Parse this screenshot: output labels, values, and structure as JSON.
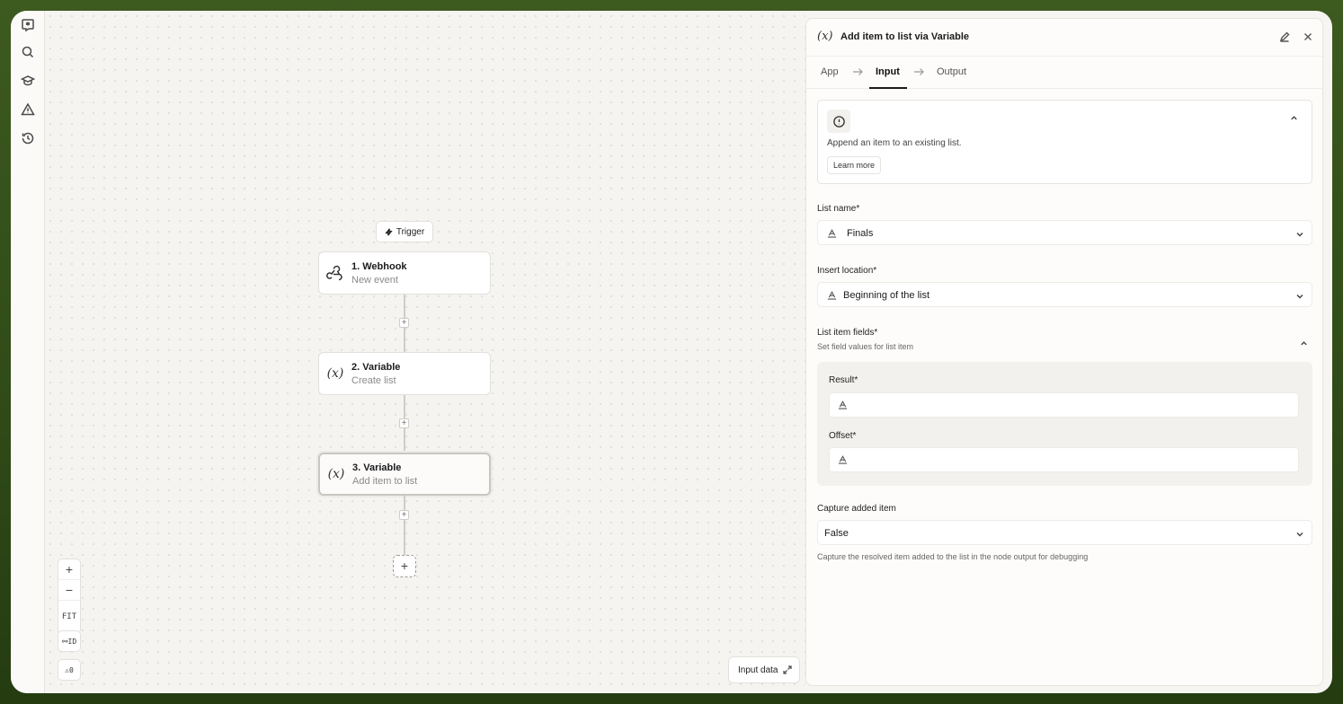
{
  "rail": {
    "icons": [
      "logo-icon",
      "search-icon",
      "graduation-cap-icon",
      "warning-icon",
      "history-icon"
    ]
  },
  "canvas": {
    "trigger_label": "Trigger",
    "nodes": [
      {
        "title": "1. Webhook",
        "subtitle": "New event",
        "icon": "webhook-icon"
      },
      {
        "title": "2. Variable",
        "subtitle": "Create list",
        "icon": "variable-icon"
      },
      {
        "title": "3. Variable",
        "subtitle": "Add item to list",
        "icon": "variable-icon",
        "selected": true
      }
    ],
    "add_symbol": "+",
    "zoom_in": "+",
    "zoom_out": "−",
    "fit_label": "FIT",
    "id_toggle_label": "⚯ID",
    "warnings_label": "⚠0",
    "input_data_label": "Input data"
  },
  "panel": {
    "icon_text": "(x)",
    "title": "Add item to list via Variable",
    "tabs": [
      {
        "label": "App"
      },
      {
        "label": "Input",
        "active": true
      },
      {
        "label": "Output"
      }
    ],
    "info": {
      "description": "Append an item to an existing list.",
      "learn_more": "Learn more"
    },
    "list_name": {
      "label": "List name*",
      "value": "Finals"
    },
    "insert_location": {
      "label": "Insert location*",
      "value": "Beginning of the list"
    },
    "list_item_fields": {
      "label": "List item fields*",
      "hint": "Set field values for list item",
      "fields": [
        {
          "label": "Result*",
          "value": ""
        },
        {
          "label": "Offset*",
          "value": ""
        }
      ]
    },
    "capture": {
      "label": "Capture added item",
      "value": "False",
      "hint": "Capture the resolved item added to the list in the node output for debugging"
    }
  }
}
